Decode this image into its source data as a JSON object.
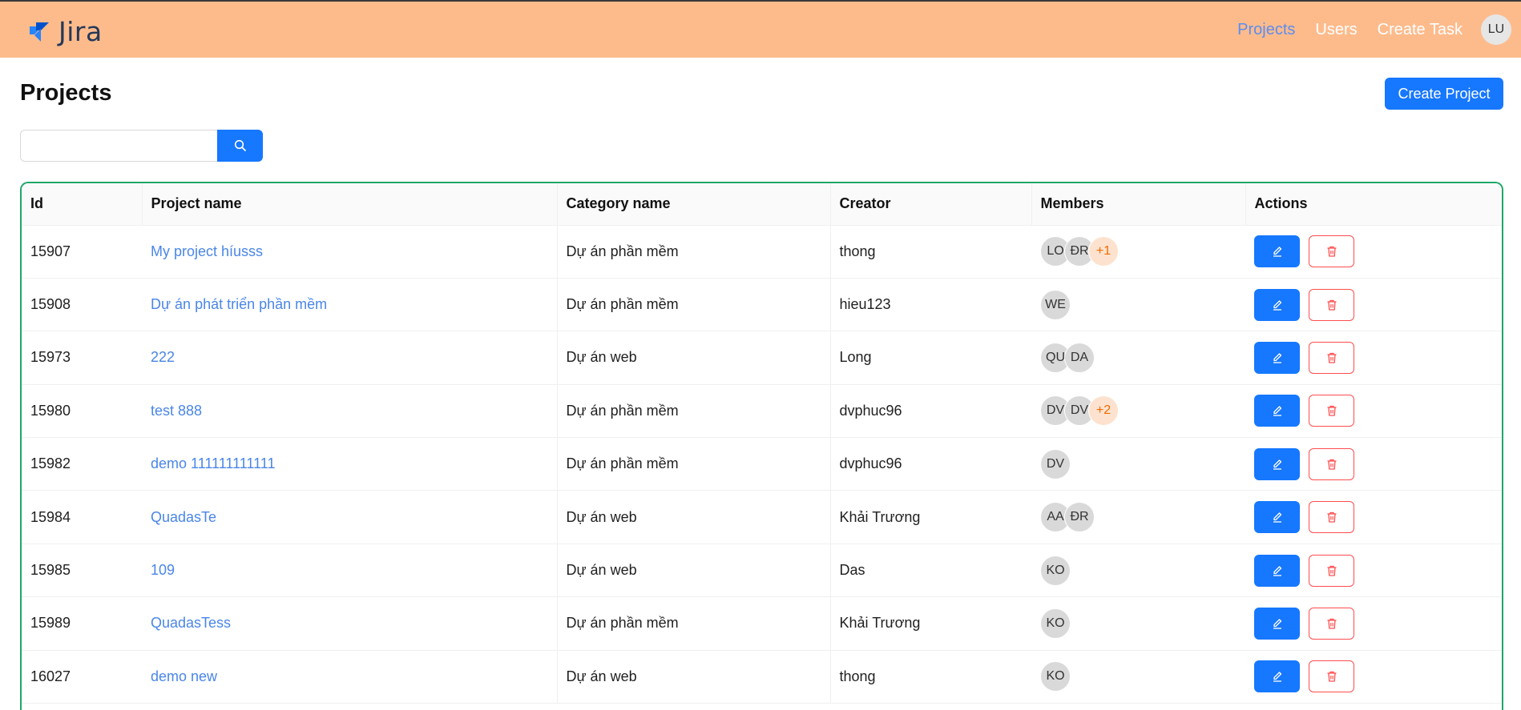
{
  "header": {
    "logo_text": "Jira",
    "nav": [
      {
        "label": "Projects",
        "active": true
      },
      {
        "label": "Users",
        "active": false
      },
      {
        "label": "Create Task",
        "active": false
      }
    ],
    "avatar": "LU",
    "colors": {
      "background": "#fdbb8c",
      "active_link": "#5b8def"
    }
  },
  "page": {
    "title": "Projects",
    "create_button": "Create Project"
  },
  "search": {
    "value": "",
    "placeholder": "",
    "button_icon": "search-icon"
  },
  "table": {
    "columns": [
      "Id",
      "Project name",
      "Category name",
      "Creator",
      "Members",
      "Actions"
    ],
    "rows": [
      {
        "id": "15907",
        "name": "My project híusss",
        "category": "Dự án phần mềm",
        "creator": "thong",
        "members": [
          "LO",
          "ĐR"
        ],
        "more": "+1"
      },
      {
        "id": "15908",
        "name": "Dự án phát triển phần mềm",
        "category": "Dự án phần mềm",
        "creator": "hieu123",
        "members": [
          "WE"
        ],
        "more": ""
      },
      {
        "id": "15973",
        "name": "222",
        "category": "Dự án web",
        "creator": "Long",
        "members": [
          "QU",
          "DA"
        ],
        "more": ""
      },
      {
        "id": "15980",
        "name": "test 888",
        "category": "Dự án phần mềm",
        "creator": "dvphuc96",
        "members": [
          "DV",
          "DV"
        ],
        "more": "+2"
      },
      {
        "id": "15982",
        "name": "demo 111111111111",
        "category": "Dự án phần mềm",
        "creator": "dvphuc96",
        "members": [
          "DV"
        ],
        "more": ""
      },
      {
        "id": "15984",
        "name": "QuadasTe",
        "category": "Dự án web",
        "creator": "Khải Trương",
        "members": [
          "AA",
          "ĐR"
        ],
        "more": ""
      },
      {
        "id": "15985",
        "name": "109",
        "category": "Dự án web",
        "creator": "Das",
        "members": [
          "KO"
        ],
        "more": ""
      },
      {
        "id": "15989",
        "name": "QuadasTess",
        "category": "Dự án phần mềm",
        "creator": "Khải Trương",
        "members": [
          "KO"
        ],
        "more": ""
      },
      {
        "id": "16027",
        "name": "demo new",
        "category": "Dự án web",
        "creator": "thong",
        "members": [
          "KO"
        ],
        "more": ""
      }
    ],
    "row_action_icons": [
      "edit-icon",
      "delete-icon"
    ],
    "colors": {
      "border": "#1fa86a",
      "link": "#4a86e8",
      "primary": "#1677ff",
      "danger": "#ff4d4f"
    }
  }
}
